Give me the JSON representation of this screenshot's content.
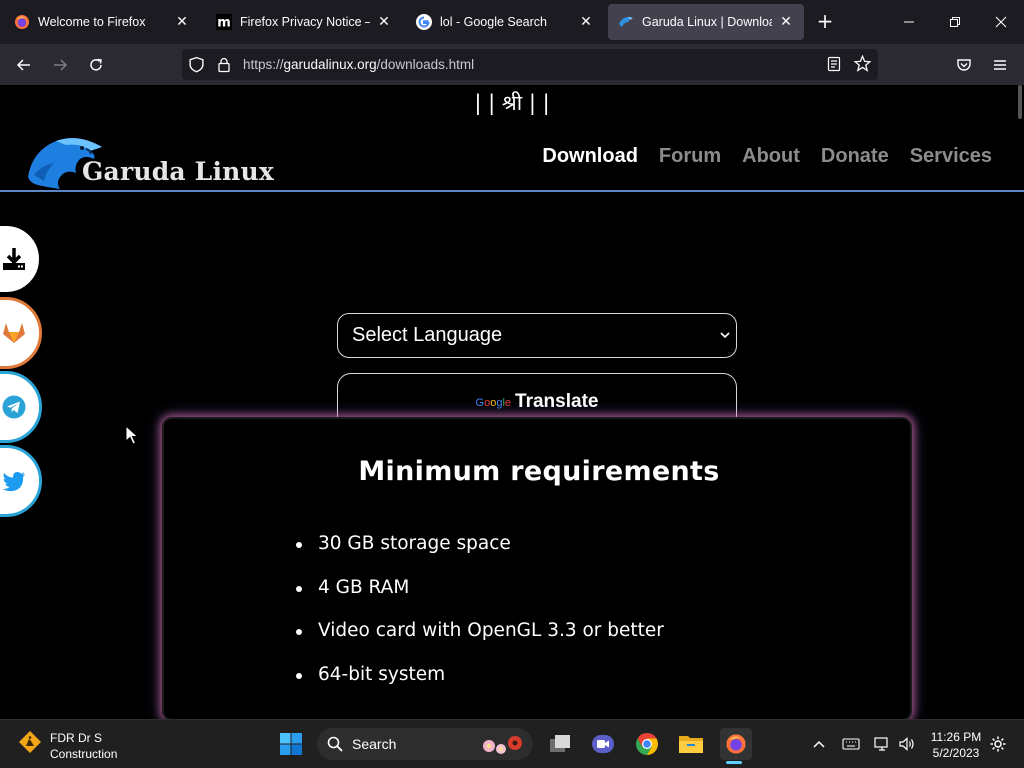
{
  "browser": {
    "tabs": [
      {
        "title": "Welcome to Firefox",
        "icon": "firefox-icon",
        "active": false
      },
      {
        "title": "Firefox Privacy Notice — M",
        "icon": "mozilla-m-icon",
        "active": false
      },
      {
        "title": "lol - Google Search",
        "icon": "google-g-icon",
        "active": false
      },
      {
        "title": "Garuda Linux | Download",
        "icon": "garuda-eagle-icon",
        "active": true
      }
    ],
    "new_tab_label": "+",
    "url_prefix": "https://",
    "url_host": "garudalinux.org",
    "url_path": "/downloads.html"
  },
  "page": {
    "shri": "| | श्री | |",
    "logo_text": "Garuda Linux",
    "nav": [
      {
        "label": "Download",
        "current": true
      },
      {
        "label": "Forum",
        "current": false
      },
      {
        "label": "About",
        "current": false
      },
      {
        "label": "Donate",
        "current": false
      },
      {
        "label": "Services",
        "current": false
      }
    ],
    "social": [
      "download-icon",
      "gitlab-icon",
      "telegram-icon",
      "twitter-icon"
    ],
    "language_select": "Select Language",
    "translate_google": "Google",
    "translate_label": "Translate",
    "requirements": {
      "title": "Minimum requirements",
      "items": [
        "30 GB storage space",
        "4 GB RAM",
        "Video card with OpenGL 3.3 or better",
        "64-bit system"
      ]
    }
  },
  "taskbar": {
    "weather_line1": "FDR Dr S",
    "weather_line2": "Construction",
    "search_label": "Search",
    "time": "11:26 PM",
    "date": "5/2/2023"
  },
  "colors": {
    "accent_line": "#5a86c8",
    "gitlab": "#e07a3a",
    "telegram": "#2aa3d6",
    "twitter": "#1d9bf0",
    "taskbar_active": "#60cdff"
  }
}
